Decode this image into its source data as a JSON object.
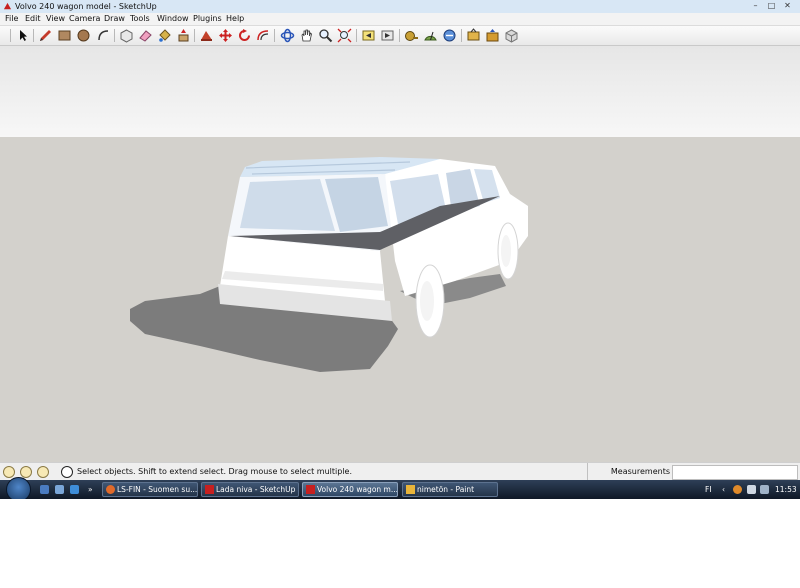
{
  "window": {
    "title": "Volvo 240 wagon model - SketchUp",
    "minimize": "–",
    "maximize": "□",
    "close": "✕"
  },
  "menu": [
    "File",
    "Edit",
    "View",
    "Camera",
    "Draw",
    "Tools",
    "Window",
    "Plugins",
    "Help"
  ],
  "toolbar": {
    "tools": [
      "select-icon",
      "pencil-icon",
      "rectangle-icon",
      "circle-icon",
      "arc-icon",
      "make-component-icon",
      "eraser-icon",
      "paint-bucket-icon",
      "push-pull-icon",
      "follow-me-icon",
      "move-icon",
      "rotate-icon",
      "offset-icon",
      "orbit-icon",
      "pan-icon",
      "zoom-icon",
      "zoom-extents-icon",
      "previous-view-icon",
      "next-view-icon",
      "tape-measure-icon",
      "protractor-icon",
      "dimension-icon",
      "get-models-icon",
      "share-model-icon",
      "component-icon",
      "section-icon"
    ]
  },
  "statusbar": {
    "text": "Select objects. Shift to extend select. Drag mouse to select multiple.",
    "measurements_label": "Measurements",
    "measurements_value": ""
  },
  "taskbar": {
    "quicklaunch_more": "»",
    "tasks": [
      {
        "label": "LS-FIN - Suomen su...",
        "active": false
      },
      {
        "label": "Lada niva - SketchUp",
        "active": false
      },
      {
        "label": "Volvo 240 wagon m...",
        "active": true
      },
      {
        "label": "nimetön - Paint",
        "active": false
      }
    ],
    "tray_lang": "FI",
    "tray_arrow": "‹",
    "clock": "11:53"
  },
  "colors": {
    "sky": "#ececec",
    "ground": "#d3d1cc",
    "model_body": "#ffffff",
    "model_glass": "#cfe0f0",
    "shadow": "#7c7c7c"
  }
}
